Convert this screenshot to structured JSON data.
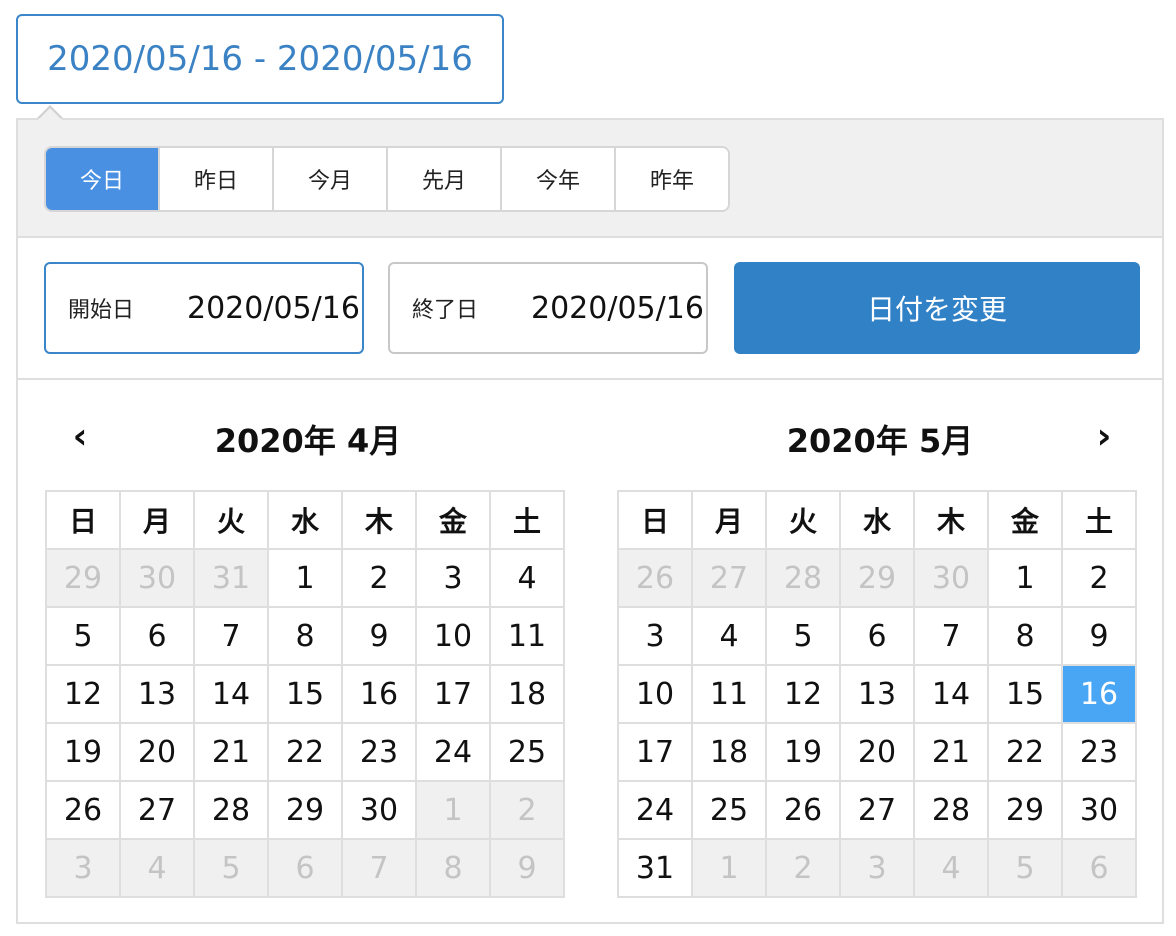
{
  "trigger": {
    "text": "2020/05/16 - 2020/05/16"
  },
  "presets": [
    {
      "label": "今日",
      "active": true
    },
    {
      "label": "昨日",
      "active": false
    },
    {
      "label": "今月",
      "active": false
    },
    {
      "label": "先月",
      "active": false
    },
    {
      "label": "今年",
      "active": false
    },
    {
      "label": "昨年",
      "active": false
    }
  ],
  "start": {
    "label": "開始日",
    "value": "2020/05/16"
  },
  "end": {
    "label": "終了日",
    "value": "2020/05/16"
  },
  "apply_label": "日付を変更",
  "nav": {
    "prev": "‹",
    "next": "›"
  },
  "weekdays": [
    "日",
    "月",
    "火",
    "水",
    "木",
    "金",
    "土"
  ],
  "months": [
    {
      "title": "2020年 4月",
      "weeks": [
        [
          {
            "d": "29",
            "off": true
          },
          {
            "d": "30",
            "off": true
          },
          {
            "d": "31",
            "off": true
          },
          {
            "d": "1"
          },
          {
            "d": "2"
          },
          {
            "d": "3"
          },
          {
            "d": "4"
          }
        ],
        [
          {
            "d": "5"
          },
          {
            "d": "6"
          },
          {
            "d": "7"
          },
          {
            "d": "8"
          },
          {
            "d": "9"
          },
          {
            "d": "10"
          },
          {
            "d": "11"
          }
        ],
        [
          {
            "d": "12"
          },
          {
            "d": "13"
          },
          {
            "d": "14"
          },
          {
            "d": "15"
          },
          {
            "d": "16"
          },
          {
            "d": "17"
          },
          {
            "d": "18"
          }
        ],
        [
          {
            "d": "19"
          },
          {
            "d": "20"
          },
          {
            "d": "21"
          },
          {
            "d": "22"
          },
          {
            "d": "23"
          },
          {
            "d": "24"
          },
          {
            "d": "25"
          }
        ],
        [
          {
            "d": "26"
          },
          {
            "d": "27"
          },
          {
            "d": "28"
          },
          {
            "d": "29"
          },
          {
            "d": "30"
          },
          {
            "d": "1",
            "off": true
          },
          {
            "d": "2",
            "off": true
          }
        ],
        [
          {
            "d": "3",
            "off": true
          },
          {
            "d": "4",
            "off": true
          },
          {
            "d": "5",
            "off": true
          },
          {
            "d": "6",
            "off": true
          },
          {
            "d": "7",
            "off": true
          },
          {
            "d": "8",
            "off": true
          },
          {
            "d": "9",
            "off": true
          }
        ]
      ]
    },
    {
      "title": "2020年 5月",
      "weeks": [
        [
          {
            "d": "26",
            "off": true
          },
          {
            "d": "27",
            "off": true
          },
          {
            "d": "28",
            "off": true
          },
          {
            "d": "29",
            "off": true
          },
          {
            "d": "30",
            "off": true
          },
          {
            "d": "1"
          },
          {
            "d": "2"
          }
        ],
        [
          {
            "d": "3"
          },
          {
            "d": "4"
          },
          {
            "d": "5"
          },
          {
            "d": "6"
          },
          {
            "d": "7"
          },
          {
            "d": "8"
          },
          {
            "d": "9"
          }
        ],
        [
          {
            "d": "10"
          },
          {
            "d": "11"
          },
          {
            "d": "12"
          },
          {
            "d": "13"
          },
          {
            "d": "14"
          },
          {
            "d": "15"
          },
          {
            "d": "16",
            "sel": true
          }
        ],
        [
          {
            "d": "17"
          },
          {
            "d": "18"
          },
          {
            "d": "19"
          },
          {
            "d": "20"
          },
          {
            "d": "21"
          },
          {
            "d": "22"
          },
          {
            "d": "23"
          }
        ],
        [
          {
            "d": "24"
          },
          {
            "d": "25"
          },
          {
            "d": "26"
          },
          {
            "d": "27"
          },
          {
            "d": "28"
          },
          {
            "d": "29"
          },
          {
            "d": "30"
          }
        ],
        [
          {
            "d": "31"
          },
          {
            "d": "1",
            "off": true
          },
          {
            "d": "2",
            "off": true
          },
          {
            "d": "3",
            "off": true
          },
          {
            "d": "4",
            "off": true
          },
          {
            "d": "5",
            "off": true
          },
          {
            "d": "6",
            "off": true
          }
        ]
      ]
    }
  ]
}
